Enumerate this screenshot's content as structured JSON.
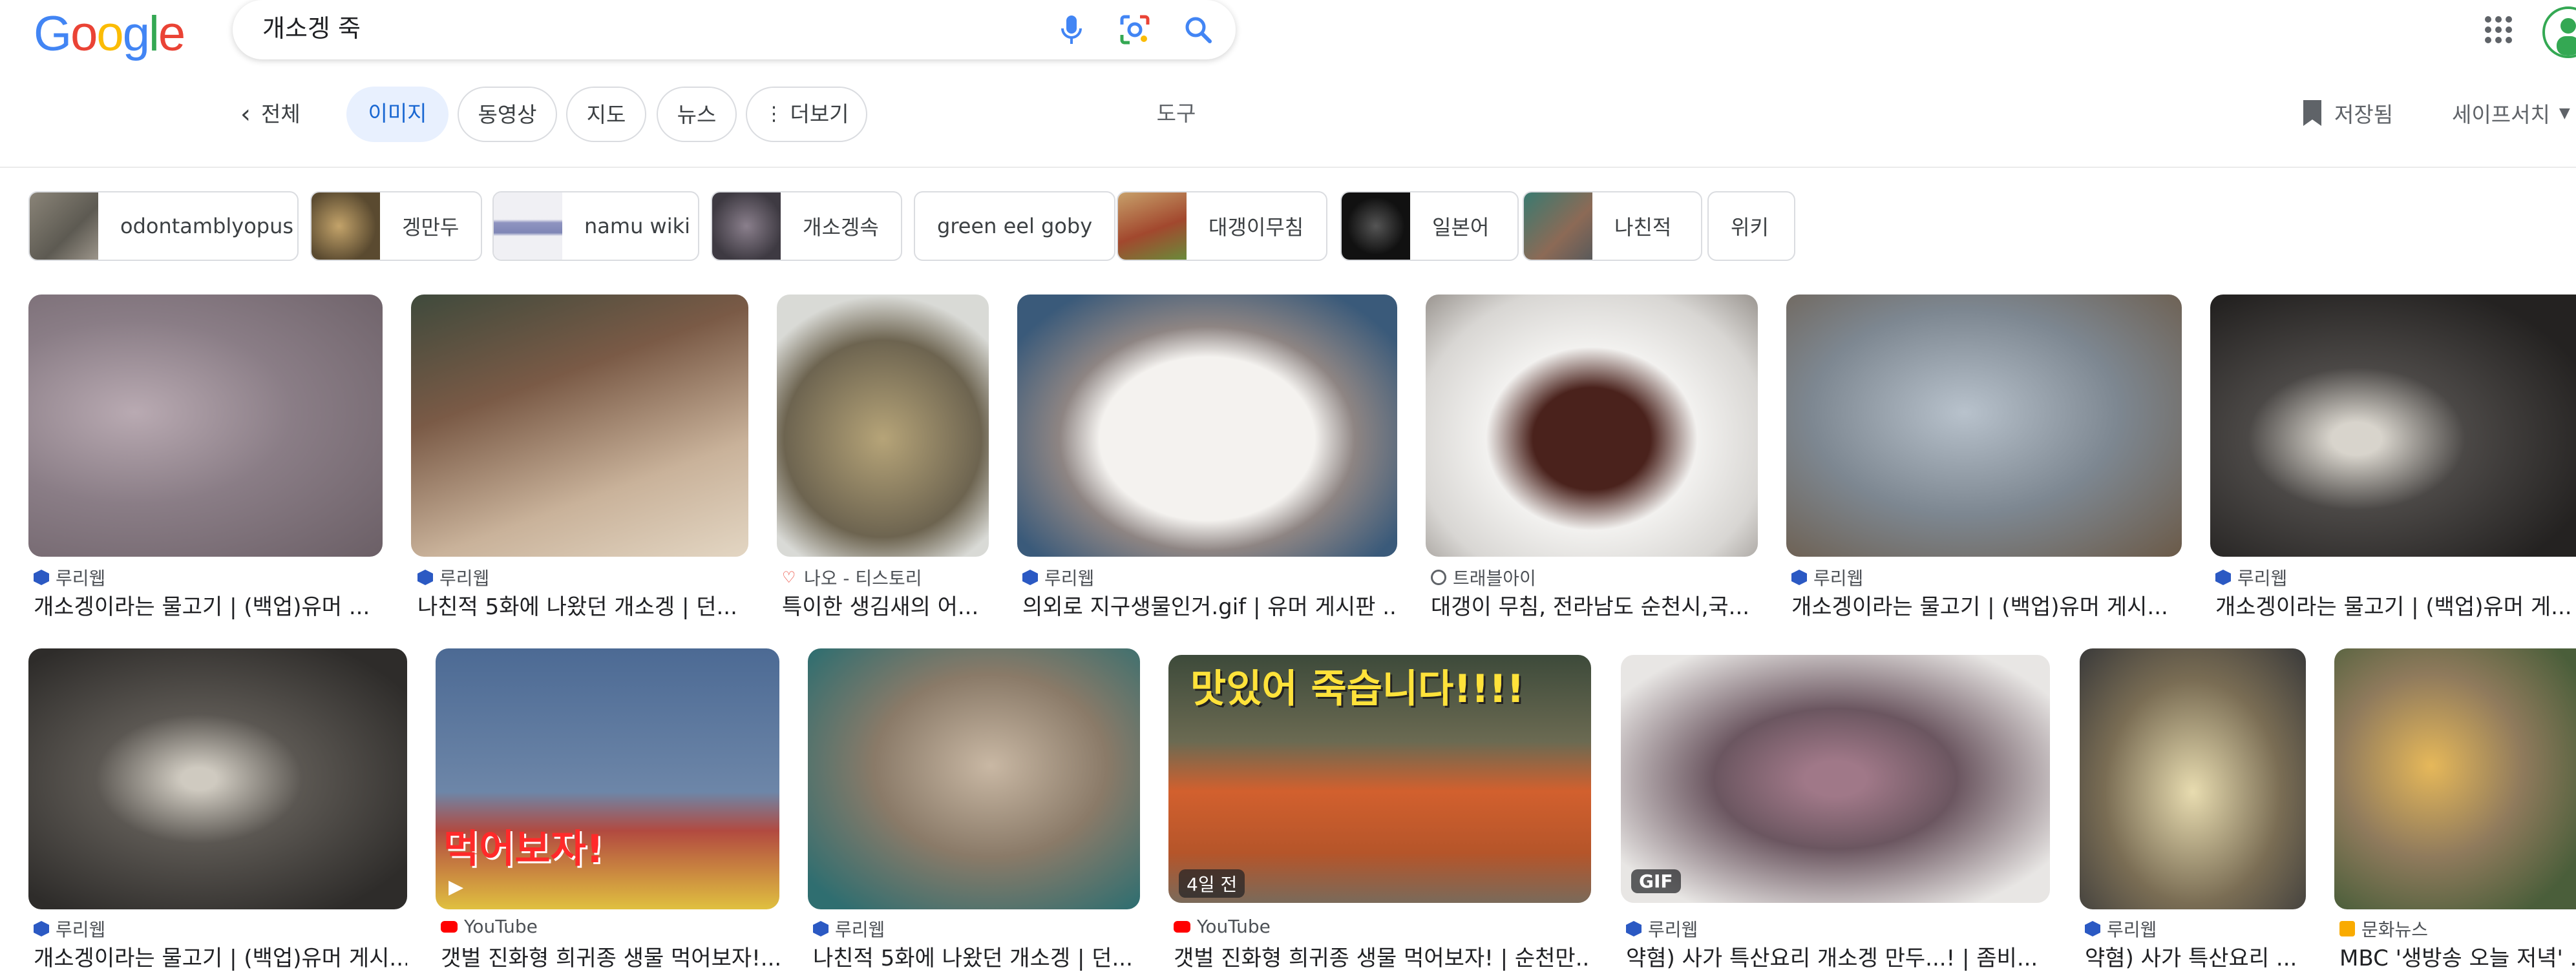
{
  "header": {
    "logo_letters": [
      "G",
      "o",
      "o",
      "g",
      "l",
      "e"
    ],
    "logo_colors": [
      "#4285f4",
      "#ea4335",
      "#fbbc05",
      "#4285f4",
      "#34a853",
      "#ea4335"
    ],
    "query": "개소겡 죽",
    "icons": [
      "microphone-icon",
      "camera-lens-icon",
      "search-icon",
      "apps-grid-icon"
    ]
  },
  "nav": {
    "tabs": [
      "전체",
      "이미지",
      "동영상",
      "지도",
      "뉴스",
      "더보기"
    ],
    "active": "이미지",
    "tools": "도구",
    "saved": "저장됨",
    "safesearch": "세이프서치"
  },
  "chips": [
    {
      "label": "odontamblyopus",
      "color": "#6f6c66"
    },
    {
      "label": "겡만두",
      "color": "#8d7a55"
    },
    {
      "label": "namu wiki",
      "color": "#7f86b6"
    },
    {
      "label": "개소겡속",
      "color": "#5a5560"
    },
    {
      "label": "green eel goby",
      "color": ""
    },
    {
      "label": "대갱이무침",
      "color": "#a2482e"
    },
    {
      "label": "일본어",
      "color": "#111111"
    },
    {
      "label": "나친적",
      "color": "#51706a"
    },
    {
      "label": "위키",
      "color": ""
    }
  ],
  "row1": [
    {
      "source": "루리웹",
      "title": "개소겡이라는 물고기 | (백업)유머 ...",
      "fav": "blue-hex-icon",
      "bg": "#a0929a"
    },
    {
      "source": "루리웹",
      "title": "나친적 5화에 나왔던 개소겡 | 던...",
      "fav": "blue-hex-icon",
      "bg": "#7a5a46"
    },
    {
      "source": "나오 - 티스토리",
      "title": "특이한 생김새의 어...",
      "fav": "heart-icon",
      "bg": "#8b7f5c"
    },
    {
      "source": "루리웹",
      "title": "의외로 지구생물인거.gif | 유머 게시판 ...",
      "fav": "blue-hex-icon",
      "bg": "#8e8583"
    },
    {
      "source": "트래블아이",
      "title": "대갱이 무침, 전라남도 순천시,국...",
      "fav": "globe-icon",
      "bg": "#d8d6d3"
    },
    {
      "source": "루리웹",
      "title": "개소겡이라는 물고기 | (백업)유머 게시...",
      "fav": "blue-hex-icon",
      "bg": "#7d8791"
    },
    {
      "source": "루리웹",
      "title": "개소겡이라는 물고기 | (백업)유머 게...",
      "fav": "blue-hex-icon",
      "bg": "#4b4846"
    }
  ],
  "row2": [
    {
      "source": "루리웹",
      "title": "개소겡이라는 물고기 | (백업)유머 게시...",
      "fav": "blue-hex-icon",
      "bg": "#5b5752",
      "overlay": ""
    },
    {
      "source": "YouTube",
      "title": "갯벌 진화형 희귀종 생물 먹어보자!...",
      "fav": "youtube-icon",
      "bg": "#4c6a94",
      "overlay": "먹어보자!"
    },
    {
      "source": "루리웹",
      "title": "나친적 5화에 나왔던 개소겡 | 던...",
      "fav": "blue-hex-icon",
      "bg": "#8a7a68",
      "overlay": ""
    },
    {
      "source": "YouTube",
      "title": "갯벌 진화형 희귀종 생물 먹어보자! | 순천만...",
      "fav": "youtube-icon",
      "bg": "#b5552a",
      "overlay": "맛있어 죽습니다!!!!",
      "badge": "4일 전"
    },
    {
      "source": "루리웹",
      "title": "약혐) 사가 특산요리 개소겡 만두...! | 좀비...",
      "fav": "blue-hex-icon",
      "bg": "#6b5660",
      "badge": "GIF"
    },
    {
      "source": "루리웹",
      "title": "약혐) 사가 특산요리 ...",
      "fav": "blue-hex-icon",
      "bg": "#7a6d54"
    },
    {
      "source": "문화뉴스",
      "title": "MBC '생방송 오늘 저녁' ...",
      "fav": "news-icon",
      "bg": "#8f7a5c"
    }
  ]
}
